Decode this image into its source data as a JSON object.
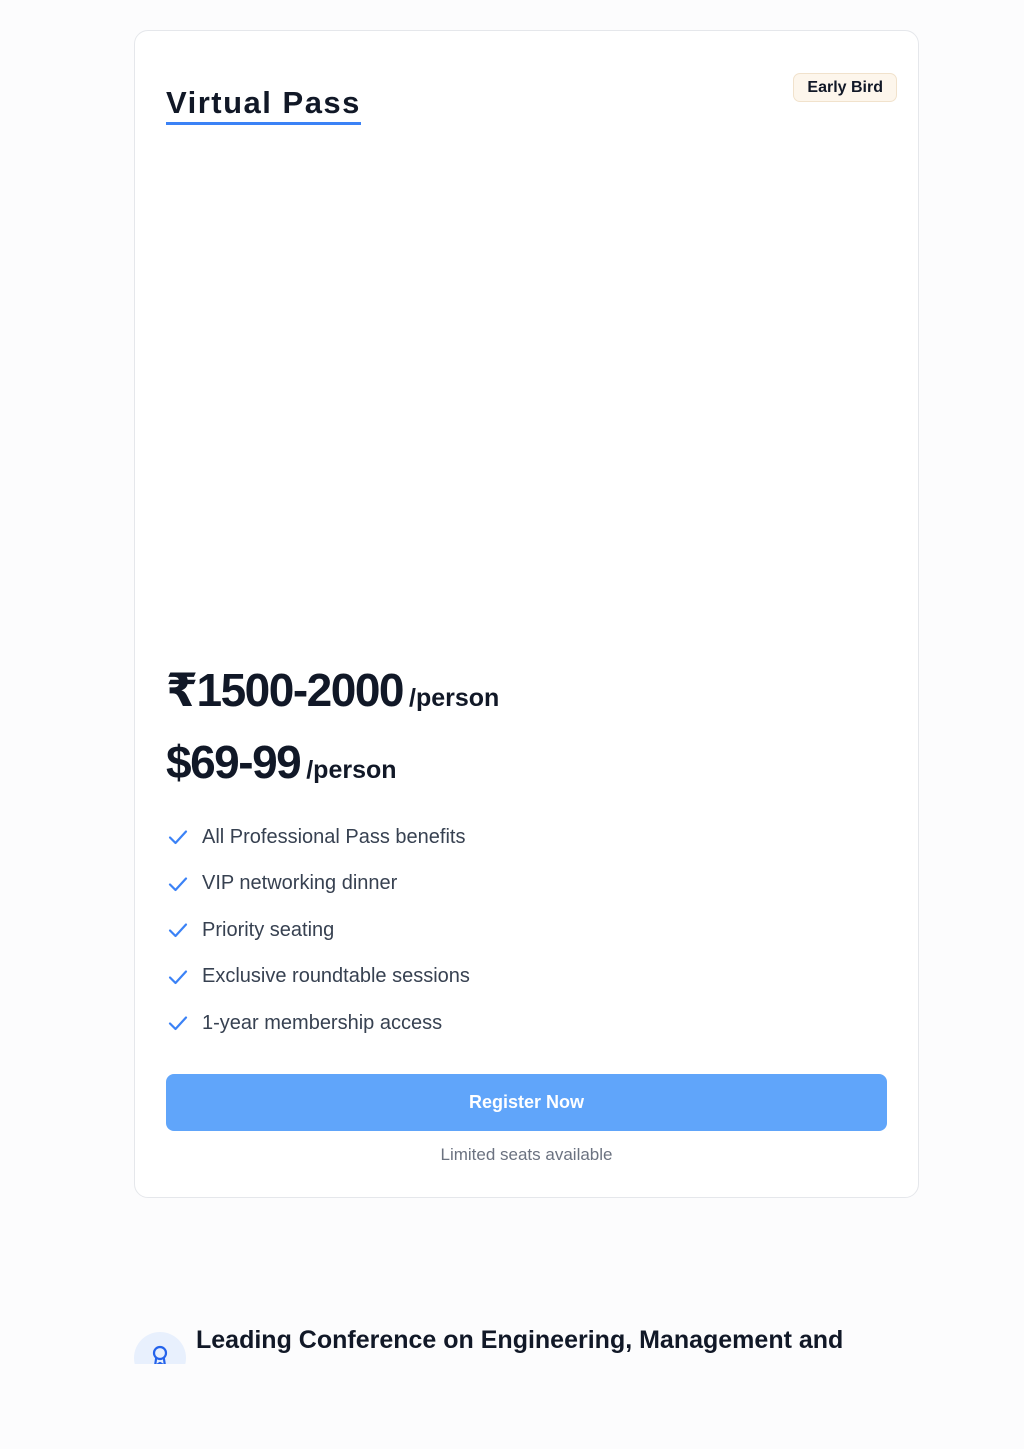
{
  "pass_card": {
    "title": "Virtual Pass",
    "badge": "Early Bird",
    "prices": [
      {
        "amount": "₹1500-2000",
        "unit": "/person"
      },
      {
        "amount": "$69-99",
        "unit": "/person"
      }
    ],
    "features": [
      "All Professional Pass benefits",
      "VIP networking dinner",
      "Priority seating",
      "Exclusive roundtable sessions",
      "1-year membership access"
    ],
    "register_label": "Register Now",
    "note": "Limited seats available"
  },
  "footer": {
    "heading": "Leading Conference on Engineering, Management and",
    "icon": "award-icon"
  },
  "colors": {
    "accent": "#3b82f6",
    "button": "#60a5fa",
    "badge_bg": "#fdf6ec"
  }
}
